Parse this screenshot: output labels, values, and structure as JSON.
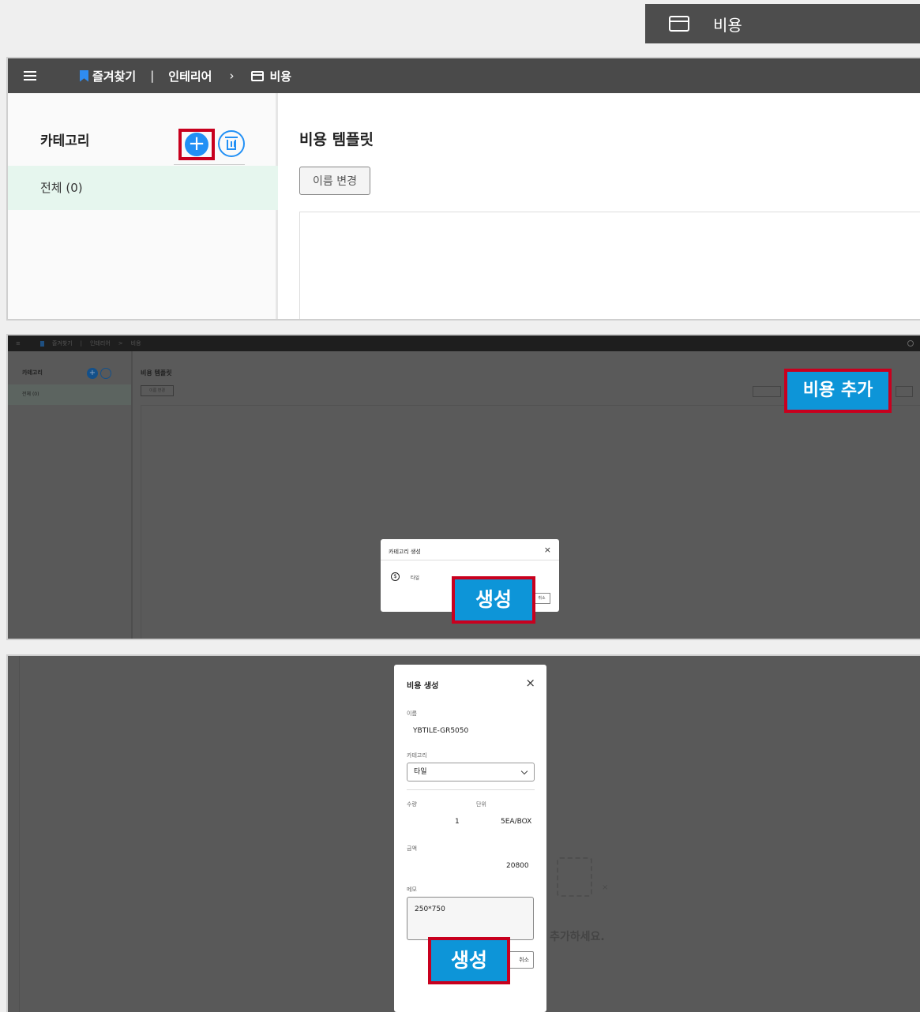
{
  "top_label": {
    "icon": "wallet-icon",
    "text": "비용"
  },
  "panel1": {
    "breadcrumb": {
      "favorites": "즐겨찾기",
      "separator": "|",
      "section": "인테리어",
      "chevron": "›",
      "page": "비용"
    },
    "sidebar": {
      "title": "카테고리",
      "add_symbol": "+",
      "all_label": "전체 (0)"
    },
    "main": {
      "title": "비용 템플릿",
      "rename_button": "이름 변경"
    }
  },
  "panel2": {
    "breadcrumb": {
      "favorites": "즐겨찾기",
      "separator": "|",
      "section": "인테리어",
      "chevron": ">",
      "page": "비용"
    },
    "sidebar": {
      "title": "카테고리",
      "add_symbol": "+",
      "all_label": "전체 (0)"
    },
    "main": {
      "title": "비용 템플릿",
      "rename_button": "이름 변경"
    },
    "callout_add_cost": "비용 추가",
    "category_modal": {
      "title": "카테고리 생성",
      "close": "×",
      "coin_symbol": "$",
      "value": "타일",
      "cancel": "취소"
    },
    "callout_create": "생성"
  },
  "panel3": {
    "modal": {
      "title": "비용 생성",
      "close": "×",
      "name_label": "이름",
      "name_value": "YBTILE-GR5050",
      "category_label": "카테고리",
      "category_value": "타일",
      "quantity_label": "수량",
      "quantity_value": "1",
      "unit_label": "단위",
      "unit_value": "5EA/BOX",
      "amount_label": "금액",
      "amount_value": "20800",
      "memo_label": "메모",
      "memo_value": "250*750",
      "cancel": "취소"
    },
    "background_hint": "추가하세요.",
    "callout_create": "생성"
  },
  "colors": {
    "accent_blue": "#2290f5",
    "callout_blue": "#0d95d8",
    "callout_red": "#c8001e",
    "appbar": "#4a4a4a"
  }
}
